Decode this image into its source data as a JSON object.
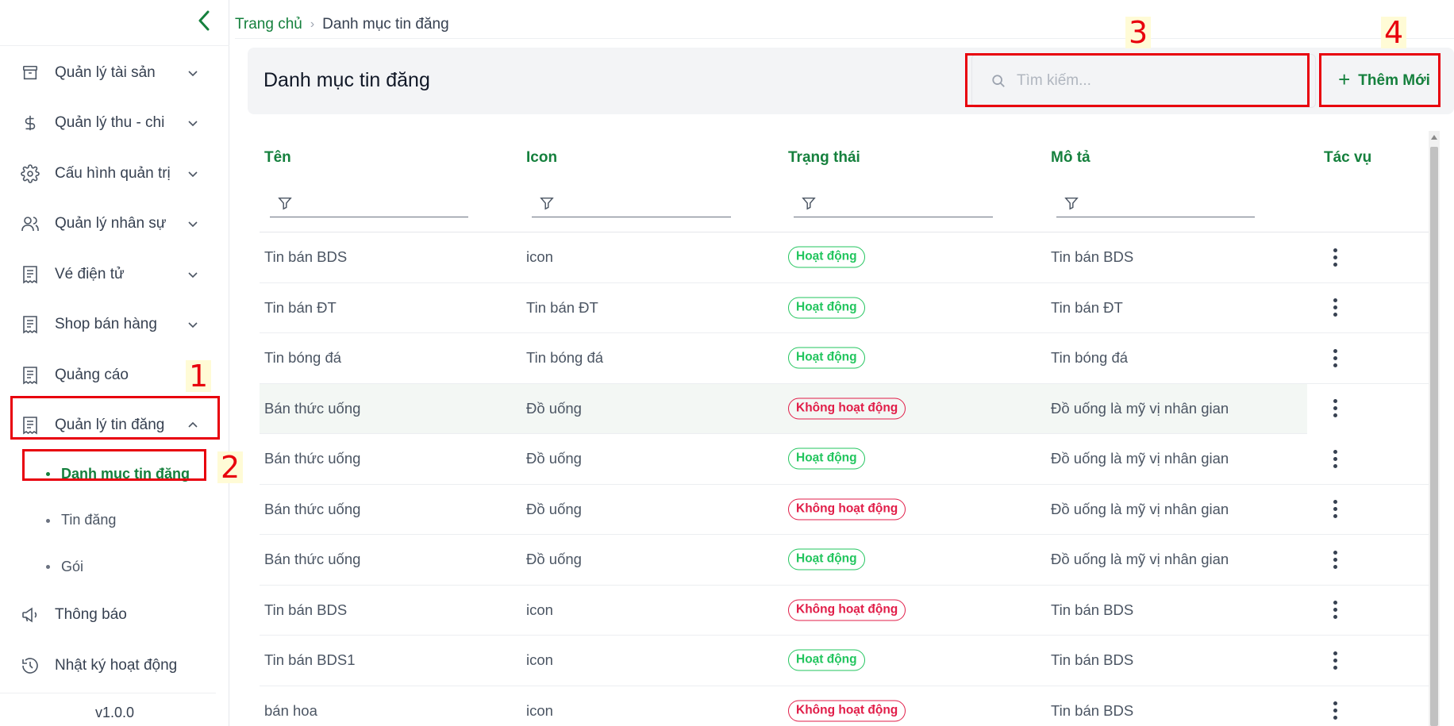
{
  "sidebar": {
    "items": [
      {
        "label": "Quản lý tài sản",
        "icon": "archive-icon"
      },
      {
        "label": "Quản lý thu - chi",
        "icon": "dollar-icon"
      },
      {
        "label": "Cấu hình quản trị",
        "icon": "gear-icon"
      },
      {
        "label": "Quản lý nhân sự",
        "icon": "users-icon"
      },
      {
        "label": "Vé điện tử",
        "icon": "receipt-icon"
      },
      {
        "label": "Shop bán hàng",
        "icon": "receipt-icon"
      },
      {
        "label": "Quảng cáo",
        "icon": "receipt-icon"
      },
      {
        "label": "Quản lý tin đăng",
        "icon": "receipt-icon"
      }
    ],
    "subitems": [
      "Danh mục tin đăng",
      "Tin đăng",
      "Gói"
    ],
    "bottom_items": [
      {
        "label": "Thông báo",
        "icon": "megaphone-icon"
      },
      {
        "label": "Nhật ký hoạt động",
        "icon": "history-icon"
      }
    ],
    "version": "v1.0.0"
  },
  "breadcrumb": {
    "home": "Trang chủ",
    "separator": "›",
    "current": "Danh mục tin đăng"
  },
  "header": {
    "title": "Danh mục tin đăng",
    "search_placeholder": "Tìm kiếm...",
    "add_label": "Thêm Mới"
  },
  "annotations": [
    "1",
    "2",
    "3",
    "4"
  ],
  "table": {
    "columns": [
      "Tên",
      "Icon",
      "Trạng thái",
      "Mô tả",
      "Tác vụ"
    ],
    "rows": [
      {
        "name": "Tin bán BDS",
        "icon": "icon",
        "status": "Hoạt động",
        "active": true,
        "desc": "Tin bán BDS"
      },
      {
        "name": "Tin bán ĐT",
        "icon": "Tin bán ĐT",
        "status": "Hoạt động",
        "active": true,
        "desc": "Tin bán ĐT"
      },
      {
        "name": "Tin bóng đá",
        "icon": "Tin bóng đá",
        "status": "Hoạt động",
        "active": true,
        "desc": "Tin bóng đá"
      },
      {
        "name": "Bán thức uống",
        "icon": "Đồ uống",
        "status": "Không hoạt động",
        "active": false,
        "desc": "Đồ uống là mỹ vị nhân gian"
      },
      {
        "name": "Bán thức uống",
        "icon": "Đồ uống",
        "status": "Hoạt động",
        "active": true,
        "desc": "Đồ uống là mỹ vị nhân gian"
      },
      {
        "name": "Bán thức uống",
        "icon": "Đồ uống",
        "status": "Không hoạt động",
        "active": false,
        "desc": "Đồ uống là mỹ vị nhân gian"
      },
      {
        "name": "Bán thức uống",
        "icon": "Đồ uống",
        "status": "Hoạt động",
        "active": true,
        "desc": "Đồ uống là mỹ vị nhân gian"
      },
      {
        "name": "Tin bán BDS",
        "icon": "icon",
        "status": "Không hoạt động",
        "active": false,
        "desc": "Tin bán BDS"
      },
      {
        "name": "Tin bán BDS1",
        "icon": "icon",
        "status": "Hoạt động",
        "active": true,
        "desc": "Tin bán BDS"
      },
      {
        "name": "bán hoa",
        "icon": "icon",
        "status": "Không hoạt động",
        "active": false,
        "desc": "Tin bán BDS"
      }
    ]
  },
  "colors": {
    "accent": "#15803d",
    "active_badge": "#22c55e",
    "inactive_badge": "#e11d48",
    "annotation": "#e8000d"
  }
}
